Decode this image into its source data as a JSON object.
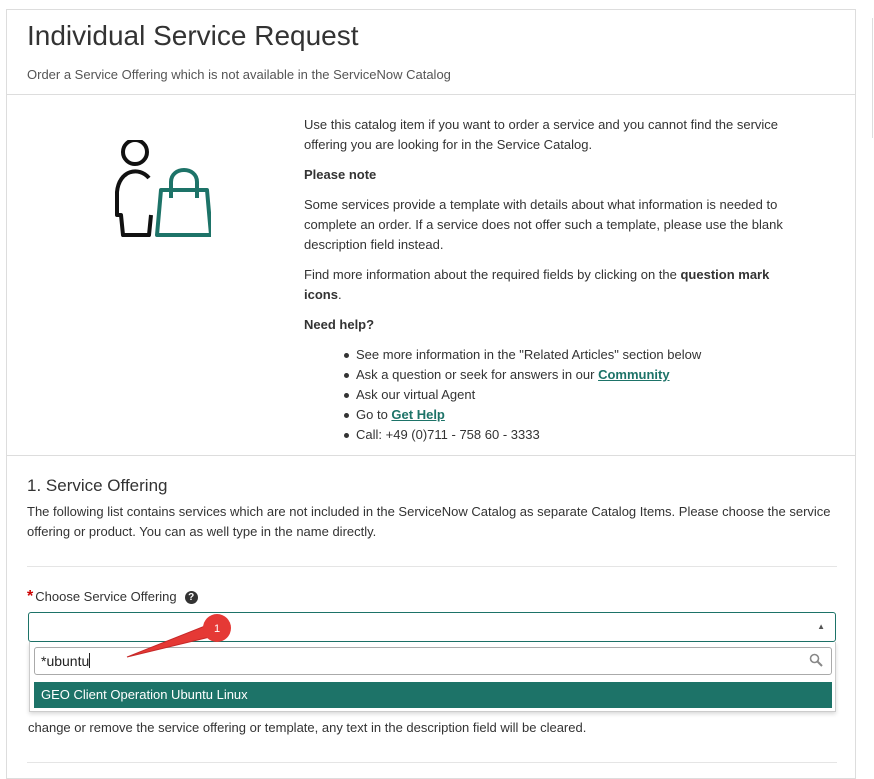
{
  "header": {
    "title": "Individual Service Request",
    "subtitle": "Order a Service Offering which is not available in the ServiceNow Catalog"
  },
  "intro": {
    "p1": "Use this catalog item if you want to order a service and you cannot find the service offering you are looking for in the Service Catalog.",
    "please_note": "Please note",
    "p2": "Some services provide a template with details about what information is needed to complete an order. If a service does not offer such a template, please use the blank description field instead.",
    "p3_prefix": "Find more information about the required fields by clicking on the ",
    "p3_bold": "question mark icons",
    "p3_suffix": ".",
    "need_help": "Need help?",
    "items": {
      "i1": "See more information in the \"Related Articles\" section below",
      "i2_prefix": "Ask a question or seek for answers in our ",
      "i2_link": "Community",
      "i3": "Ask our virtual Agent",
      "i4_prefix": "Go to ",
      "i4_link": "Get Help",
      "i5": "Call: +49 (0)711 - 758 60 - 3333"
    }
  },
  "section": {
    "title": "1. Service Offering",
    "description": "The following list contains services which are not included in the ServiceNow Catalog as separate Catalog Items. Please choose the service offering or product. You can as well type in the name directly.",
    "field_label": "Choose Service Offering",
    "required_mark": "*",
    "help_glyph": "?",
    "under_text": "change or remove the service offering or template, any text in the description field will be cleared."
  },
  "dropdown": {
    "search_value": "*ubuntu",
    "options": [
      "GEO Client Operation Ubuntu Linux"
    ]
  },
  "annotation": {
    "badge": "1"
  },
  "icons": {
    "illustration": "person-shopping-bag-icon",
    "help": "question-circle-icon",
    "caret": "caret-up-icon",
    "search": "search-icon"
  },
  "colors": {
    "accent": "#1d7368",
    "required": "#cc0000",
    "annotation": "#e53935"
  }
}
